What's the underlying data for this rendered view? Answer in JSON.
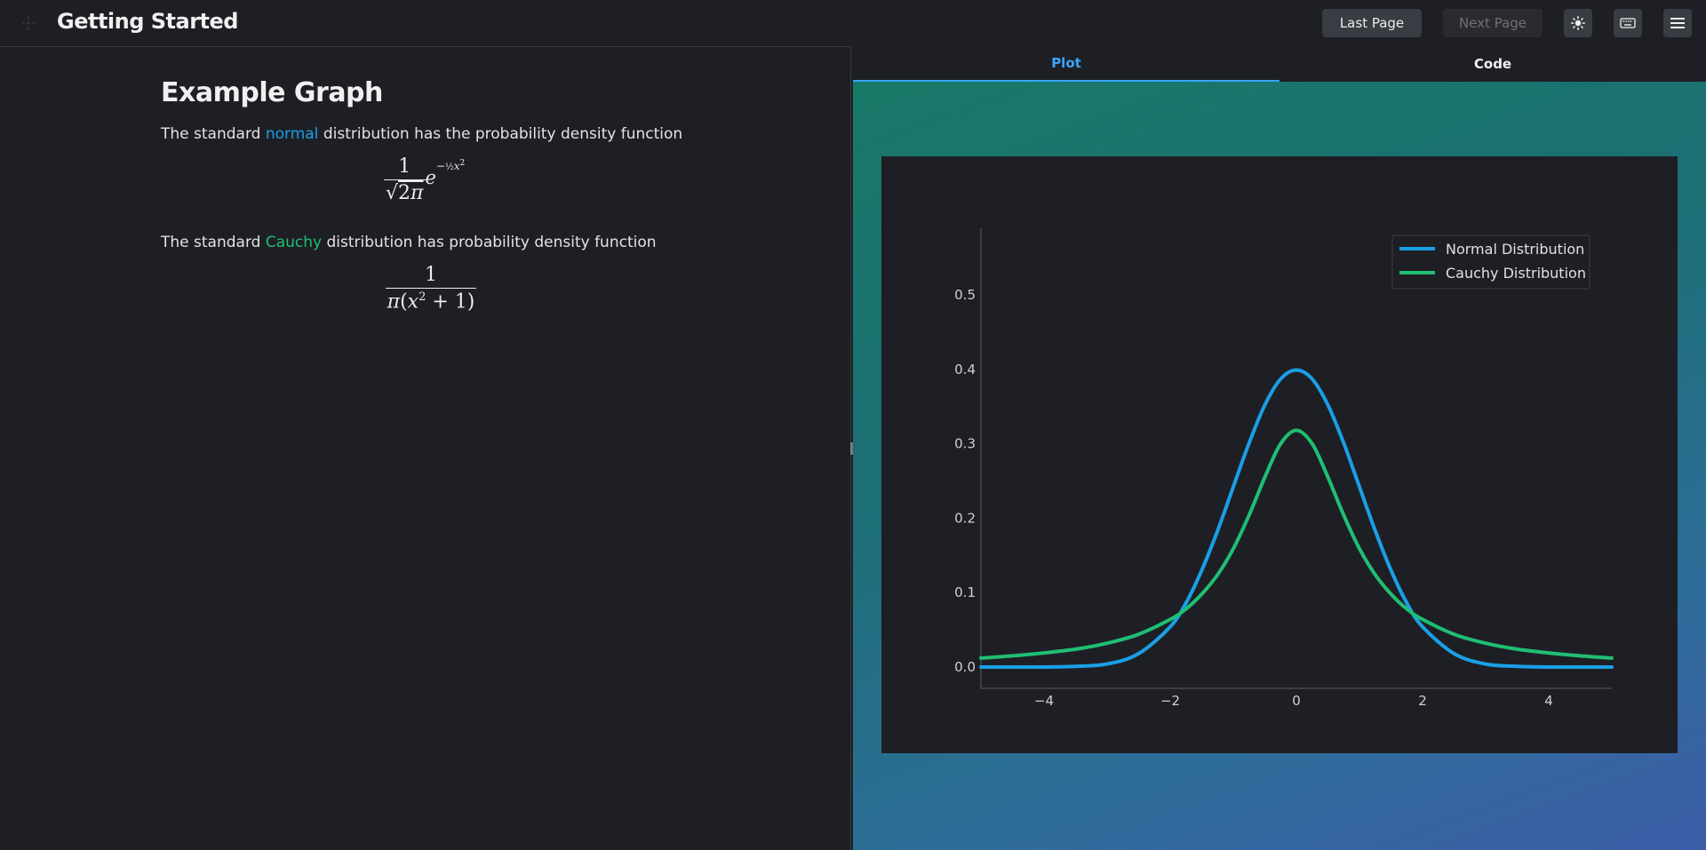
{
  "header": {
    "title": "Getting Started",
    "last_page_label": "Last Page",
    "next_page_label": "Next Page"
  },
  "doc": {
    "title": "Example Graph",
    "p1_before": "The standard ",
    "p1_link": "normal",
    "p1_after": " distribution has the probability density function",
    "p2_before": "The standard ",
    "p2_link": "Cauchy",
    "p2_after": " distribution has probability density function"
  },
  "tabs": {
    "plot": "Plot",
    "code": "Code"
  },
  "colors": {
    "normal": "#1a9fe6",
    "cauchy": "#1fbf73"
  },
  "chart_data": {
    "type": "line",
    "xlim": [
      -5,
      5
    ],
    "ylim": [
      0,
      0.6
    ],
    "x_ticks": [
      -4,
      -2,
      0,
      2,
      4
    ],
    "x_tick_labels": [
      "−4",
      "−2",
      "0",
      "2",
      "4"
    ],
    "y_ticks": [
      0,
      0.1,
      0.2,
      0.3,
      0.4,
      0.5
    ],
    "y_tick_labels": [
      "0.0",
      "0.1",
      "0.2",
      "0.3",
      "0.4",
      "0.5"
    ],
    "legend_position": "top-right",
    "grid": false,
    "x": [
      -5,
      -4.5,
      -4,
      -3.5,
      -3,
      -2.5,
      -2,
      -1.75,
      -1.5,
      -1.25,
      -1,
      -0.75,
      -0.5,
      -0.25,
      0,
      0.25,
      0.5,
      0.75,
      1,
      1.25,
      1.5,
      1.75,
      2,
      2.5,
      3,
      3.5,
      4,
      4.5,
      5
    ],
    "series": [
      {
        "name": "Normal Distribution",
        "values": [
          0.0,
          0.0,
          0.0,
          0.001,
          0.004,
          0.018,
          0.054,
          0.086,
          0.13,
          0.183,
          0.242,
          0.301,
          0.352,
          0.387,
          0.399,
          0.387,
          0.352,
          0.301,
          0.242,
          0.183,
          0.13,
          0.086,
          0.054,
          0.018,
          0.004,
          0.001,
          0.0,
          0.0,
          0.0
        ]
      },
      {
        "name": "Cauchy Distribution",
        "values": [
          0.012,
          0.015,
          0.019,
          0.024,
          0.032,
          0.044,
          0.064,
          0.078,
          0.098,
          0.124,
          0.159,
          0.204,
          0.255,
          0.3,
          0.318,
          0.3,
          0.255,
          0.204,
          0.159,
          0.124,
          0.098,
          0.078,
          0.064,
          0.044,
          0.032,
          0.024,
          0.019,
          0.015,
          0.012
        ]
      }
    ]
  }
}
